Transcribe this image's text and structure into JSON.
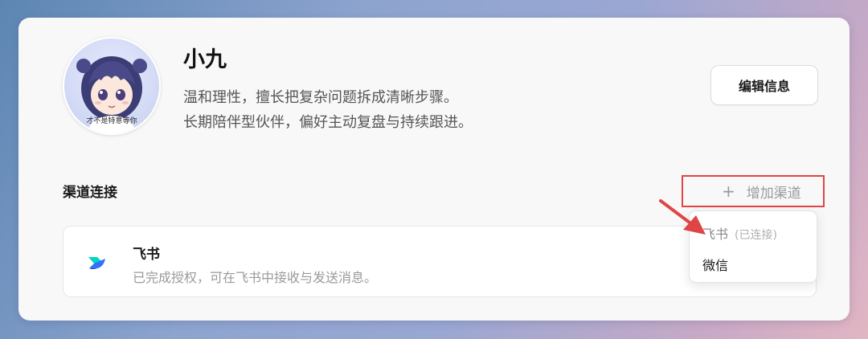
{
  "profile": {
    "name": "小九",
    "description_line1": "温和理性，擅长把复杂问题拆成清晰步骤。",
    "description_line2": "长期陪伴型伙伴，偏好主动复盘与持续跟进。",
    "avatar_caption": "才不是特意等你"
  },
  "toolbar": {
    "edit_label": "编辑信息"
  },
  "channels": {
    "section_title": "渠道连接",
    "add_icon": "plus-icon",
    "add_label": "增加渠道",
    "items": [
      {
        "name": "飞书",
        "icon": "feishu-icon",
        "description": "已完成授权，可在飞书中接收与发送消息。"
      }
    ]
  },
  "dropdown": {
    "options": [
      {
        "label": "飞书",
        "state": "(已连接)"
      },
      {
        "label": "微信"
      }
    ]
  },
  "colors": {
    "highlight": "#e04545",
    "feishu_blue": "#3370ff",
    "feishu_teal": "#00d6b9",
    "feishu_navy": "#133c9a"
  }
}
